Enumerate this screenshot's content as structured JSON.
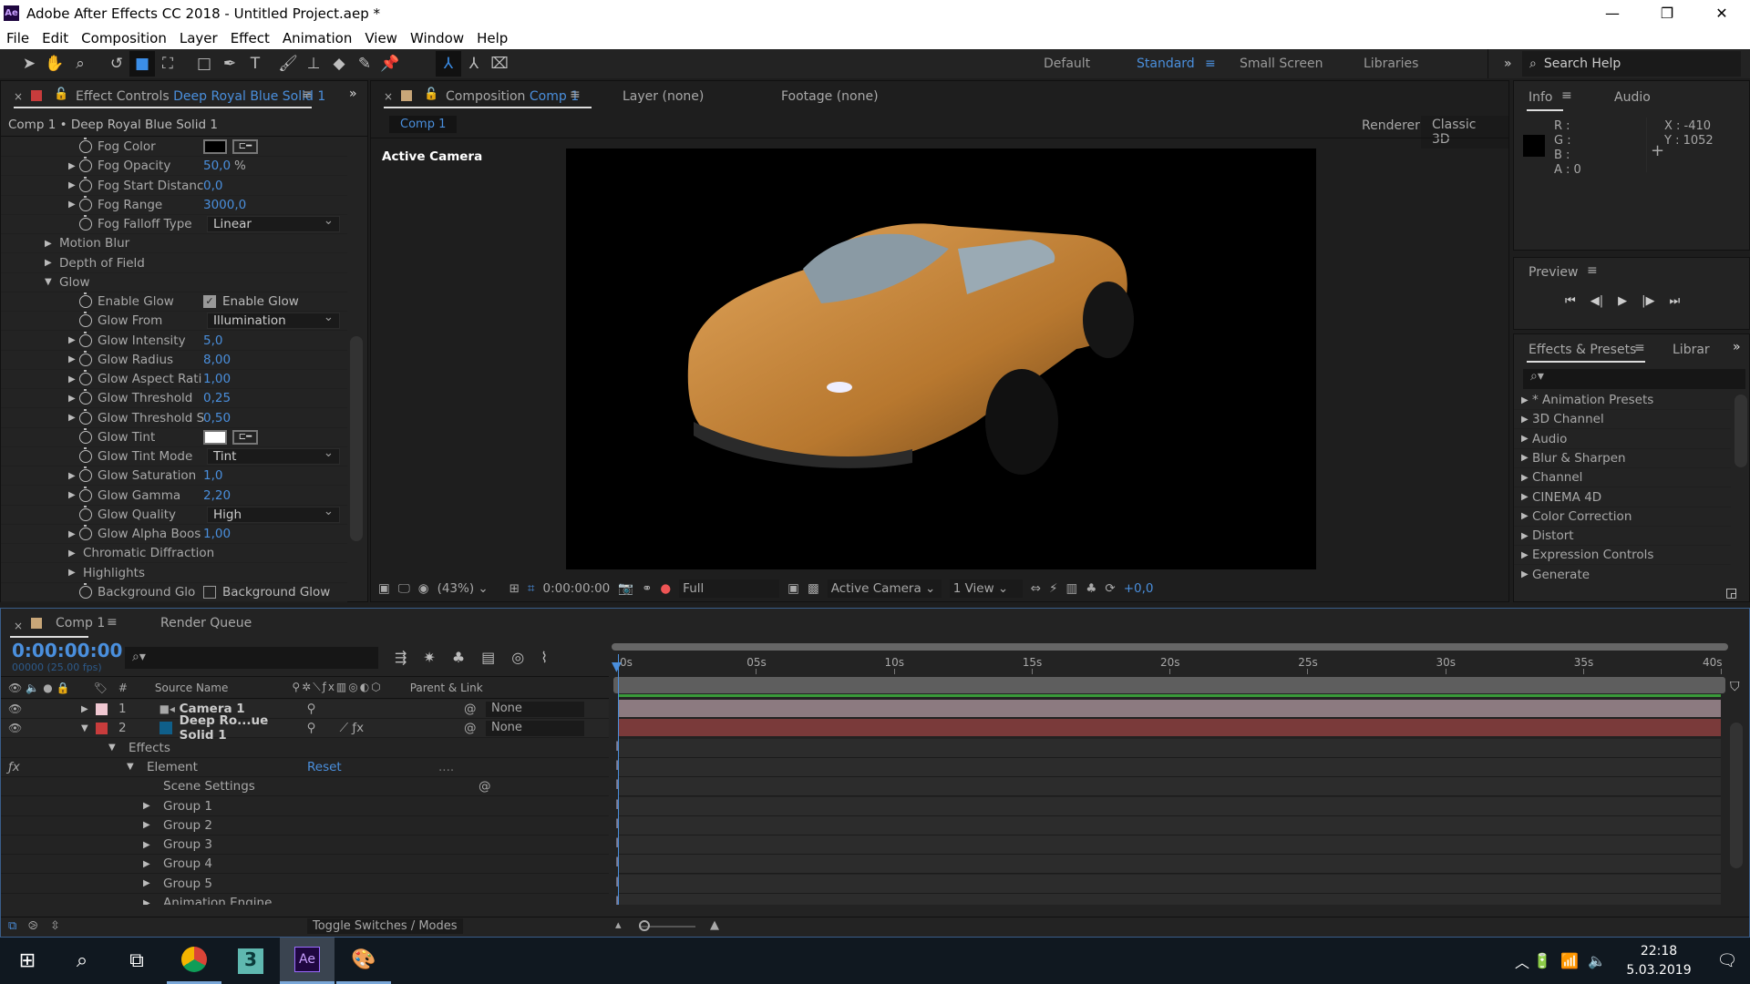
{
  "window": {
    "title": "Adobe After Effects CC 2018 - Untitled Project.aep *",
    "logo": "Ae"
  },
  "menu": [
    "File",
    "Edit",
    "Composition",
    "Layer",
    "Effect",
    "Animation",
    "View",
    "Window",
    "Help"
  ],
  "workspaces": {
    "items": [
      "Default",
      "Standard",
      "Small Screen",
      "Libraries"
    ],
    "active": "Standard",
    "search_placeholder": "Search Help"
  },
  "effect_controls": {
    "tab_label": "Effect Controls",
    "layer_name": "Deep Royal Blue Solid 1",
    "breadcrumb": "Comp 1 • Deep Royal Blue Solid 1",
    "rows": [
      {
        "label": "Fog Color",
        "twirl": "",
        "sw": true,
        "type": "color",
        "color": "#000000"
      },
      {
        "label": "Fog Opacity",
        "twirl": "closed",
        "sw": true,
        "type": "num",
        "value": "50,0",
        "unit": "%"
      },
      {
        "label": "Fog Start Distanc",
        "twirl": "closed",
        "sw": true,
        "type": "num",
        "value": "0,0"
      },
      {
        "label": "Fog Range",
        "twirl": "closed",
        "sw": true,
        "type": "num",
        "value": "3000,0"
      },
      {
        "label": "Fog Falloff Type",
        "twirl": "",
        "sw": true,
        "type": "dd",
        "value": "Linear"
      },
      {
        "label": "Motion Blur",
        "twirl": "closed",
        "group": true
      },
      {
        "label": "Depth of Field",
        "twirl": "closed",
        "group": true
      },
      {
        "label": "Glow",
        "twirl": "open",
        "group": true
      },
      {
        "label": "Enable Glow",
        "twirl": "",
        "sw": true,
        "type": "check",
        "checked": true,
        "value": "Enable Glow"
      },
      {
        "label": "Glow From",
        "twirl": "",
        "sw": true,
        "type": "dd",
        "value": "Illumination"
      },
      {
        "label": "Glow Intensity",
        "twirl": "closed",
        "sw": true,
        "type": "num",
        "value": "5,0"
      },
      {
        "label": "Glow Radius",
        "twirl": "closed",
        "sw": true,
        "type": "num",
        "value": "8,00"
      },
      {
        "label": "Glow Aspect Rati",
        "twirl": "closed",
        "sw": true,
        "type": "num",
        "value": "1,00"
      },
      {
        "label": "Glow Threshold",
        "twirl": "closed",
        "sw": true,
        "type": "num",
        "value": "0,25"
      },
      {
        "label": "Glow Threshold S",
        "twirl": "closed",
        "sw": true,
        "type": "num",
        "value": "0,50"
      },
      {
        "label": "Glow Tint",
        "twirl": "",
        "sw": true,
        "type": "color",
        "color": "#ffffff"
      },
      {
        "label": "Glow Tint Mode",
        "twirl": "",
        "sw": true,
        "type": "dd",
        "value": "Tint"
      },
      {
        "label": "Glow Saturation",
        "twirl": "closed",
        "sw": true,
        "type": "num",
        "value": "1,0"
      },
      {
        "label": "Glow Gamma",
        "twirl": "closed",
        "sw": true,
        "type": "num",
        "value": "2,20"
      },
      {
        "label": "Glow Quality",
        "twirl": "",
        "sw": true,
        "type": "dd",
        "value": "High"
      },
      {
        "label": "Glow Alpha Boos",
        "twirl": "closed",
        "sw": true,
        "type": "num",
        "value": "1,00"
      },
      {
        "label": "Chromatic Diffraction",
        "twirl": "closed",
        "group": true,
        "sub": true
      },
      {
        "label": "Highlights",
        "twirl": "closed",
        "group": true,
        "sub": true
      },
      {
        "label": "Background Glo",
        "twirl": "",
        "sw": true,
        "type": "check",
        "checked": false,
        "value": "Background Glow"
      }
    ]
  },
  "composition": {
    "tab_label": "Composition",
    "comp_name": "Comp 1",
    "layer_tab": "Layer  (none)",
    "footage_tab": "Footage  (none)",
    "comp_chip": "Comp 1",
    "renderer_label": "Renderer:",
    "renderer": "Classic 3D",
    "view_label": "Active Camera",
    "bottom": {
      "zoom": "(43%)",
      "timecode": "0:00:00:00",
      "resolution": "Full",
      "camera": "Active Camera",
      "views": "1 View",
      "exposure": "+0,0"
    },
    "car_color": "#c98a3e"
  },
  "info": {
    "tabs": [
      "Info",
      "Audio"
    ],
    "r": "R :",
    "g": "G :",
    "b": "B :",
    "a": "A : 0",
    "x": "X : -410",
    "y": "Y : 1052"
  },
  "preview": {
    "title": "Preview"
  },
  "effects_presets": {
    "tab": "Effects & Presets",
    "tab2": "Librar",
    "items": [
      "* Animation Presets",
      "3D Channel",
      "Audio",
      "Blur & Sharpen",
      "Channel",
      "CINEMA 4D",
      "Color Correction",
      "Distort",
      "Expression Controls",
      "Generate"
    ]
  },
  "timeline": {
    "tab": "Comp 1",
    "render_queue": "Render Queue",
    "timecode": "0:00:00:00",
    "frames": "00000 (25.00 fps)",
    "headers": {
      "num": "#",
      "source": "Source Name",
      "parent": "Parent & Link"
    },
    "ruler": [
      "0s",
      "05s",
      "10s",
      "15s",
      "20s",
      "25s",
      "30s",
      "35s",
      "40s"
    ],
    "layers": [
      {
        "num": "1",
        "name": "Camera 1",
        "label_color": "#f0c8d2",
        "parent": "None",
        "bar": "#8c7a80"
      },
      {
        "num": "2",
        "name": "Deep Ro...ue Solid 1",
        "label_color": "#c83c3c",
        "swatch": "#0f5f8a",
        "parent": "None",
        "bar": "#7a3a3a"
      }
    ],
    "effects_label": "Effects",
    "element_label": "Element",
    "reset": "Reset",
    "dots": "....",
    "scene": "Scene Settings",
    "groups": [
      "Group 1",
      "Group 2",
      "Group 3",
      "Group 4",
      "Group 5",
      "Animation Engine"
    ],
    "toggle": "Toggle Switches / Modes"
  },
  "taskbar": {
    "time": "22:18",
    "date": "5.03.2019"
  }
}
